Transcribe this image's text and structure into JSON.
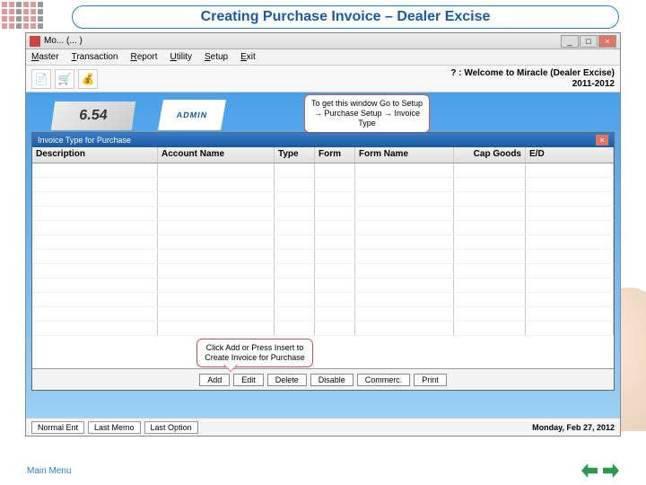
{
  "title": "Creating Purchase Invoice – Dealer Excise",
  "window": {
    "app_title": "Mo... (... )",
    "controls": {
      "min": "_",
      "max": "□",
      "close": "×"
    }
  },
  "menu": {
    "master": "Master",
    "transaction": "Transaction",
    "report": "Report",
    "utility": "Utility",
    "setup": "Setup",
    "exit": "Exit"
  },
  "toolbar": {
    "welcome_line1": "? : Welcome to Miracle (Dealer Excise)",
    "welcome_line2": "2011-2012"
  },
  "admin_label": "ADMIN",
  "bg_num": "6.54",
  "callout_top": "To get this window Go to Setup → Purchase Setup → Invoice Type",
  "dialog": {
    "title": "Invoice Type for Purchase",
    "columns": {
      "description": "Description",
      "account_name": "Account Name",
      "type": "Type",
      "form": "Form",
      "form_name": "Form Name",
      "cap_goods": "Cap Goods",
      "ed": "E/D"
    },
    "buttons": {
      "add": "Add",
      "edit": "Edit",
      "delete": "Delete",
      "disable": "Disable",
      "commerc": "Commerc.",
      "print": "Print"
    }
  },
  "callout_bottom": "Click Add or Press Insert to Create Invoice for Purchase",
  "statusbar": {
    "normal_ent": "Normal Ent",
    "last_memo": "Last Memo",
    "last_option": "Last Option",
    "date": "Monday, Feb 27, 2012"
  },
  "footer": {
    "main_menu": "Main Menu"
  }
}
